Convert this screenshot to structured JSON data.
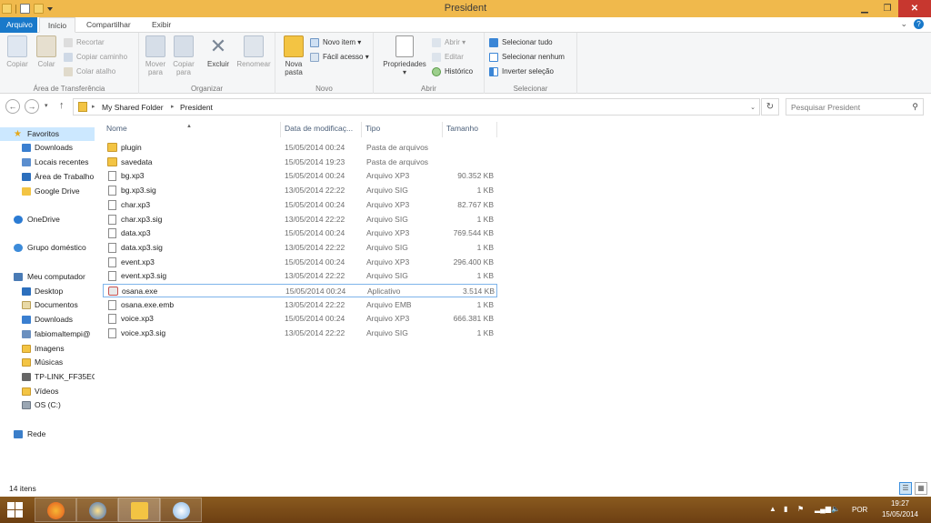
{
  "window": {
    "title": "President"
  },
  "quick_access_icons": [
    "folder-icon",
    "properties-icon",
    "new-folder-icon",
    "dropdown-icon"
  ],
  "ribbon": {
    "tabs": {
      "file": "Arquivo",
      "home": "Início",
      "share": "Compartilhar",
      "view": "Exibir"
    },
    "clipboard": {
      "label": "Área de Transferência",
      "copy": "Copiar",
      "paste": "Colar",
      "cut": "Recortar",
      "copy_path": "Copiar caminho",
      "paste_shortcut": "Colar atalho"
    },
    "organize": {
      "label": "Organizar",
      "move_to": "Mover",
      "move_to_2": "para",
      "copy_to": "Copiar",
      "copy_to_2": "para",
      "delete": "Excluir",
      "rename": "Renomear"
    },
    "new": {
      "label": "Novo",
      "new_folder": "Nova",
      "new_folder_2": "pasta",
      "new_item": "Novo item",
      "easy_access": "Fácil acesso"
    },
    "open": {
      "label": "Abrir",
      "properties": "Propriedades",
      "open": "Abrir",
      "edit": "Editar",
      "history": "Histórico"
    },
    "select": {
      "label": "Selecionar",
      "select_all": "Selecionar tudo",
      "select_none": "Selecionar nenhum",
      "invert": "Inverter seleção"
    }
  },
  "address": {
    "crumbs": [
      "My Shared Folder",
      "President"
    ],
    "search_placeholder": "Pesquisar President"
  },
  "nav": {
    "favorites": "Favoritos",
    "fav_items": [
      "Downloads",
      "Locais recentes",
      "Área de Trabalho",
      "Google Drive"
    ],
    "onedrive": "OneDrive",
    "homegroup": "Grupo doméstico",
    "computer": "Meu computador",
    "computer_items": [
      "Desktop",
      "Documentos",
      "Downloads",
      "fabiomaltempi@",
      "Imagens",
      "Músicas",
      "TP-LINK_FF35EC",
      "Vídeos",
      "OS (C:)"
    ],
    "network": "Rede"
  },
  "columns": {
    "name": "Nome",
    "date": "Data de modificaç...",
    "type": "Tipo",
    "size": "Tamanho"
  },
  "files": [
    {
      "icon": "folder-icon",
      "name": "plugin",
      "date": "15/05/2014 00:24",
      "type": "Pasta de arquivos",
      "size": ""
    },
    {
      "icon": "folder-icon",
      "name": "savedata",
      "date": "15/05/2014 19:23",
      "type": "Pasta de arquivos",
      "size": ""
    },
    {
      "icon": "file-icon",
      "name": "bg.xp3",
      "date": "15/05/2014 00:24",
      "type": "Arquivo XP3",
      "size": "90.352 KB"
    },
    {
      "icon": "file-icon",
      "name": "bg.xp3.sig",
      "date": "13/05/2014 22:22",
      "type": "Arquivo SIG",
      "size": "1 KB"
    },
    {
      "icon": "file-icon",
      "name": "char.xp3",
      "date": "15/05/2014 00:24",
      "type": "Arquivo XP3",
      "size": "82.767 KB"
    },
    {
      "icon": "file-icon",
      "name": "char.xp3.sig",
      "date": "13/05/2014 22:22",
      "type": "Arquivo SIG",
      "size": "1 KB"
    },
    {
      "icon": "file-icon",
      "name": "data.xp3",
      "date": "15/05/2014 00:24",
      "type": "Arquivo XP3",
      "size": "769.544 KB"
    },
    {
      "icon": "file-icon",
      "name": "data.xp3.sig",
      "date": "13/05/2014 22:22",
      "type": "Arquivo SIG",
      "size": "1 KB"
    },
    {
      "icon": "file-icon",
      "name": "event.xp3",
      "date": "15/05/2014 00:24",
      "type": "Arquivo XP3",
      "size": "296.400 KB"
    },
    {
      "icon": "file-icon",
      "name": "event.xp3.sig",
      "date": "13/05/2014 22:22",
      "type": "Arquivo SIG",
      "size": "1 KB"
    },
    {
      "icon": "exe-icon",
      "name": "osana.exe",
      "date": "15/05/2014 00:24",
      "type": "Aplicativo",
      "size": "3.514 KB",
      "selected": true
    },
    {
      "icon": "file-icon",
      "name": "osana.exe.emb",
      "date": "13/05/2014 22:22",
      "type": "Arquivo EMB",
      "size": "1 KB"
    },
    {
      "icon": "file-icon",
      "name": "voice.xp3",
      "date": "15/05/2014 00:24",
      "type": "Arquivo XP3",
      "size": "666.381 KB"
    },
    {
      "icon": "file-icon",
      "name": "voice.xp3.sig",
      "date": "13/05/2014 22:22",
      "type": "Arquivo SIG",
      "size": "1 KB"
    }
  ],
  "status": {
    "count": "14 itens"
  },
  "taskbar": {
    "apps": [
      "firefox-icon",
      "app-icon",
      "file-explorer-icon",
      "paint-icon"
    ],
    "lang": "POR",
    "time": "19:27",
    "date": "15/05/2014"
  },
  "colors": {
    "accent": "#1979ca",
    "titlebar": "#f0b94c",
    "close": "#c7372f",
    "taskbar": "#7a4c18",
    "selection": "#cce8ff"
  }
}
